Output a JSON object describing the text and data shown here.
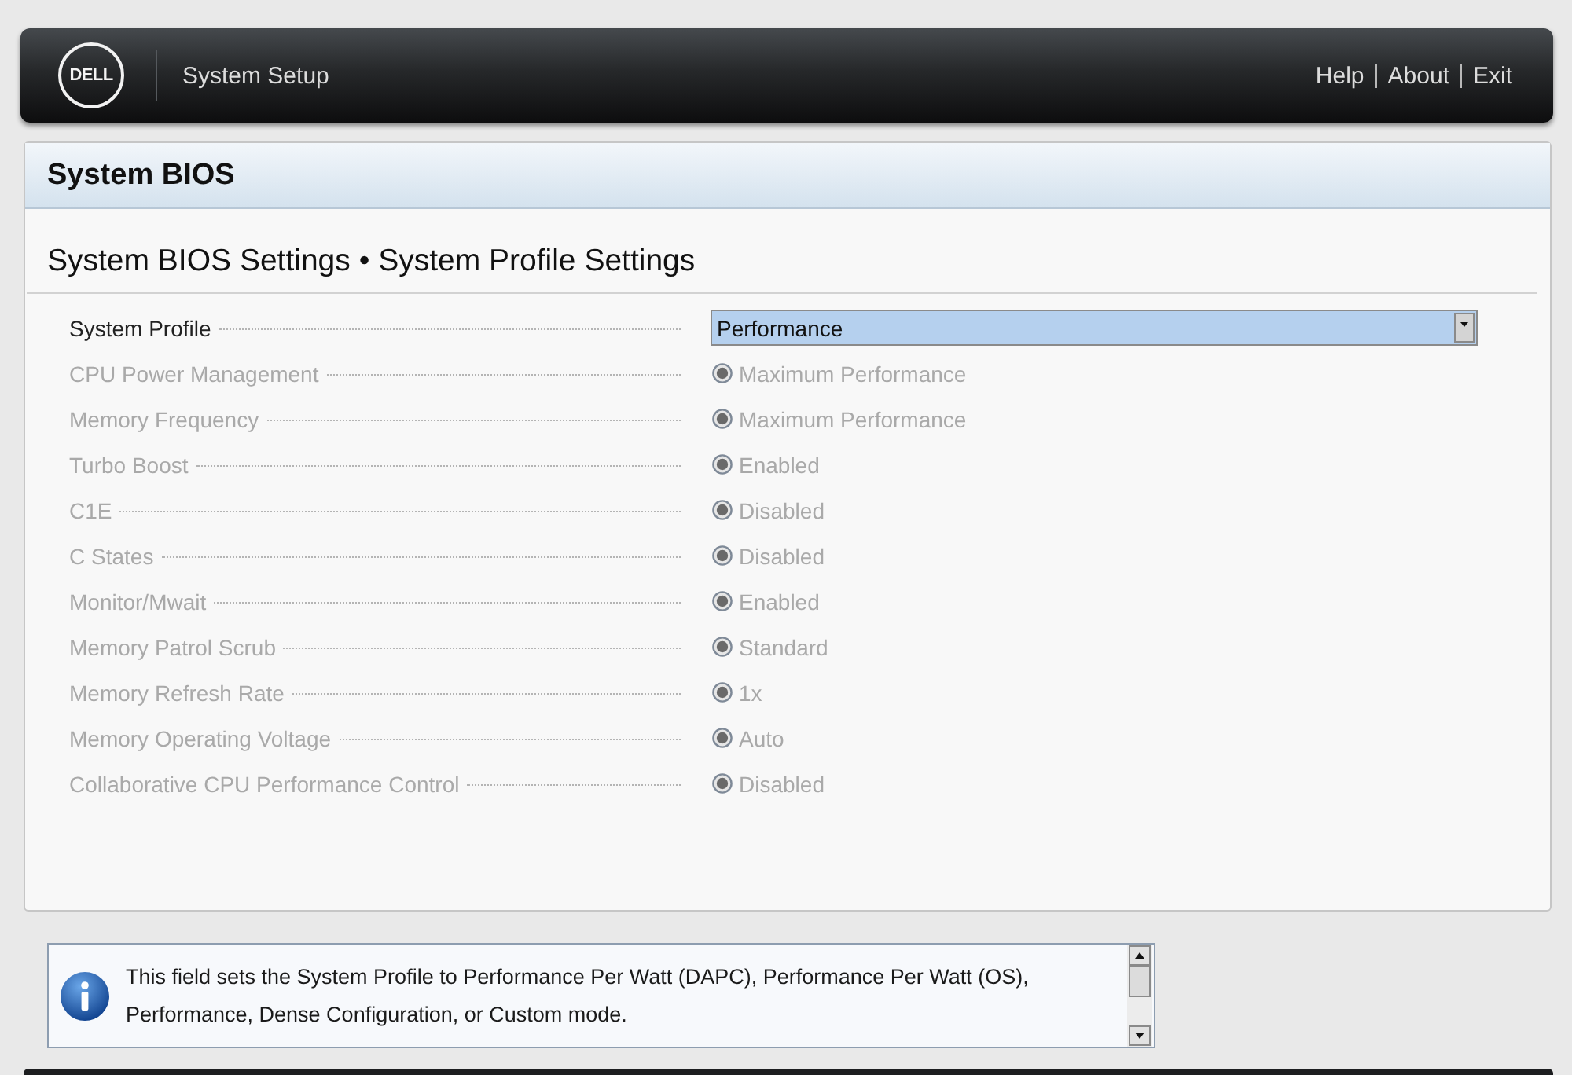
{
  "header": {
    "logo": "DELL",
    "title": "System Setup",
    "links": [
      "Help",
      "About",
      "Exit"
    ]
  },
  "panel": {
    "title": "System BIOS",
    "breadcrumb": "System BIOS Settings • System Profile Settings"
  },
  "settings": [
    {
      "kind": "dropdown",
      "label": "System Profile",
      "value": "Performance",
      "disabled": false,
      "focused": true
    },
    {
      "kind": "radio",
      "label": "CPU Power Management",
      "value": "Maximum Performance",
      "disabled": true,
      "focused": false,
      "checked": true
    },
    {
      "kind": "radio",
      "label": "Memory Frequency",
      "value": "Maximum Performance",
      "disabled": true,
      "focused": false,
      "checked": true
    },
    {
      "kind": "radio",
      "label": "Turbo Boost",
      "value": "Enabled",
      "disabled": true,
      "focused": false,
      "checked": true
    },
    {
      "kind": "radio",
      "label": "C1E",
      "value": "Disabled",
      "disabled": true,
      "focused": false,
      "checked": true
    },
    {
      "kind": "radio",
      "label": "C States",
      "value": "Disabled",
      "disabled": true,
      "focused": false,
      "checked": true
    },
    {
      "kind": "radio",
      "label": "Monitor/Mwait",
      "value": "Enabled",
      "disabled": true,
      "focused": false,
      "checked": true
    },
    {
      "kind": "radio",
      "label": "Memory Patrol Scrub",
      "value": "Standard",
      "disabled": true,
      "focused": false,
      "checked": true
    },
    {
      "kind": "radio",
      "label": "Memory Refresh Rate",
      "value": "1x",
      "disabled": true,
      "focused": false,
      "checked": true
    },
    {
      "kind": "radio",
      "label": "Memory Operating Voltage",
      "value": "Auto",
      "disabled": true,
      "focused": false,
      "checked": true
    },
    {
      "kind": "radio",
      "label": "Collaborative CPU Performance Control",
      "value": "Disabled",
      "disabled": true,
      "focused": false,
      "checked": true
    }
  ],
  "help": {
    "text": "This field sets the System Profile to Performance Per Watt (DAPC), Performance Per Watt (OS), Performance, Dense Configuration, or Custom mode."
  }
}
